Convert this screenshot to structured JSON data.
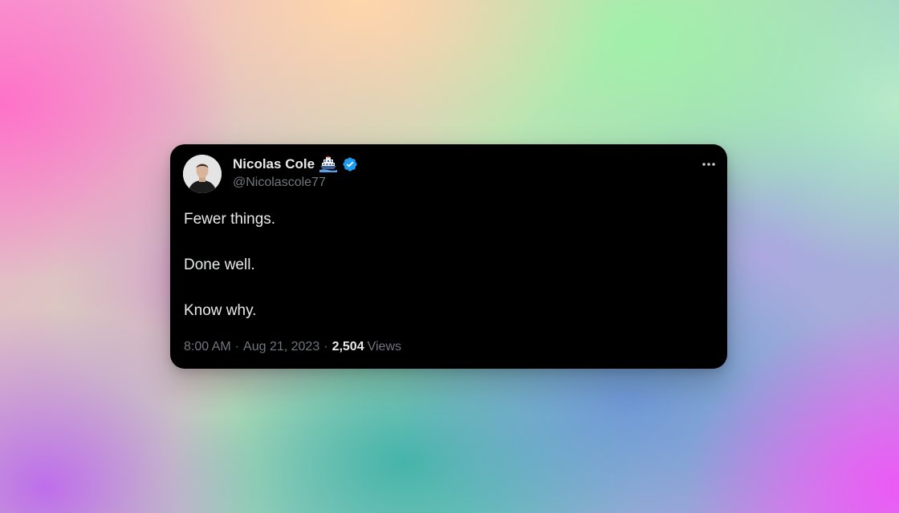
{
  "tweet": {
    "author": {
      "name": "Nicolas Cole",
      "emoji_icon": "passenger-ship-emoji-icon",
      "verified_icon": "verified-badge-icon",
      "handle": "@Nicolascole77",
      "avatar": "avatar-photo"
    },
    "more_icon": "more-horizontal-icon",
    "lines": [
      "Fewer things.",
      "Done well.",
      "Know why."
    ],
    "meta": {
      "time": "8:00 AM",
      "separator": "·",
      "date": "Aug 21, 2023",
      "views_count": "2,504",
      "views_label": "Views"
    }
  },
  "colors": {
    "card_background": "#000000",
    "primary_text": "#e7e9ea",
    "secondary_text": "#71767b",
    "verified_blue": "#1d9bf0"
  }
}
